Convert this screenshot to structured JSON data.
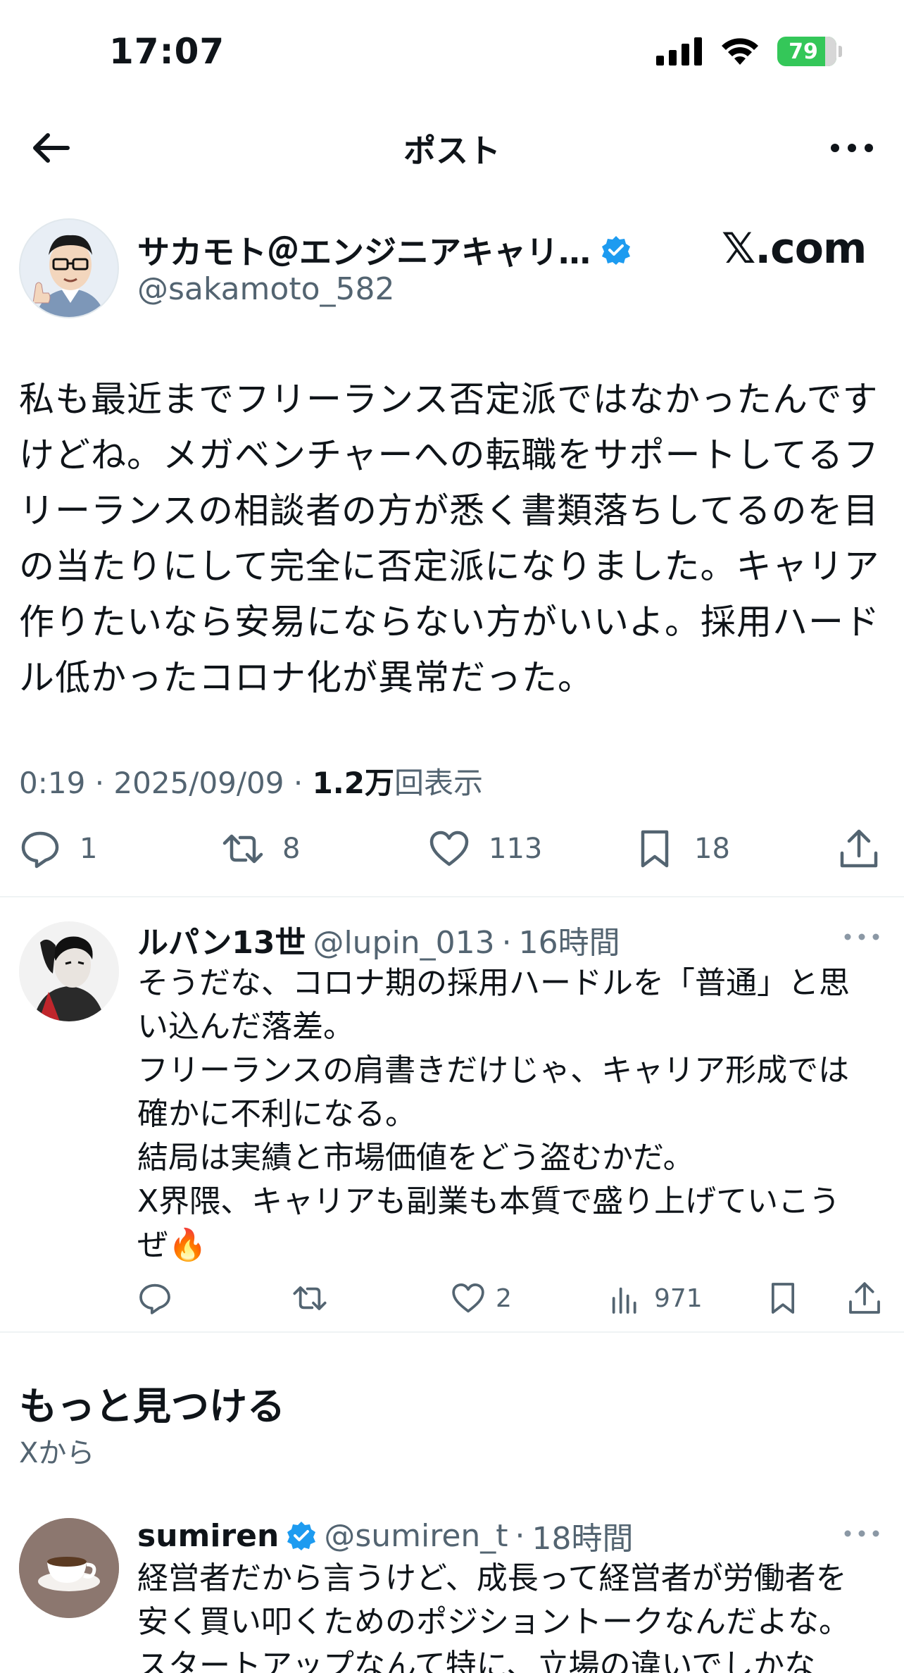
{
  "status_bar": {
    "time": "17:07",
    "battery": "79"
  },
  "nav": {
    "title": "ポスト",
    "back_icon": "arrow-left-icon",
    "more_icon": "more-horizontal-icon"
  },
  "post": {
    "display_name": "サカモト＠エンジニアキャリ…",
    "handle": "@sakamoto_582",
    "verified": true,
    "watermark": "𝕏.com",
    "text": "私も最近までフリーランス否定派ではなかったんです\nけどね。メガベンチャーへの転職をサポートしてるフ\nリーランスの相談者の方が悉く書類落ちしてるのを目\nの当たりにして完全に否定派になりました。キャリア\n作りたいなら安易にならない方がいいよ。採用ハード\nル低かったコロナ化が異常だった。",
    "time": "0:19",
    "date": "2025/09/09",
    "views": "1.2万",
    "views_label": "回表示",
    "sep": "·",
    "replies": "1",
    "reposts": "8",
    "likes": "113",
    "bookmarks": "18"
  },
  "reply": {
    "display_name": "ルパン13世",
    "handle": "@lupin_013",
    "sep": "·",
    "age": "16時間",
    "text": "そうだな、コロナ期の採用ハードルを「普通」と思\nい込んだ落差。\nフリーランスの肩書きだけじゃ、キャリア形成では\n確かに不利になる。\n結局は実績と市場価値をどう盗むかだ。\nX界隈、キャリアも副業も本質で盛り上げていこう\nぜ🔥",
    "likes": "2",
    "views": "971"
  },
  "discover": {
    "title": "もっと見つける",
    "subtitle": "Xから"
  },
  "suggested": {
    "display_name": "sumiren",
    "handle": "@sumiren_t",
    "sep": "·",
    "age": "18時間",
    "verified": true,
    "text": "経営者だから言うけど、成長って経営者が労働者を\n安く買い叩くためのポジショントークなんだよな。\nスタートアップなんて特に、立場の違いでしかな"
  },
  "colors": {
    "accent": "#1d9bf0",
    "muted": "#536471",
    "battery": "#34c759",
    "divider": "#eff3f4"
  }
}
